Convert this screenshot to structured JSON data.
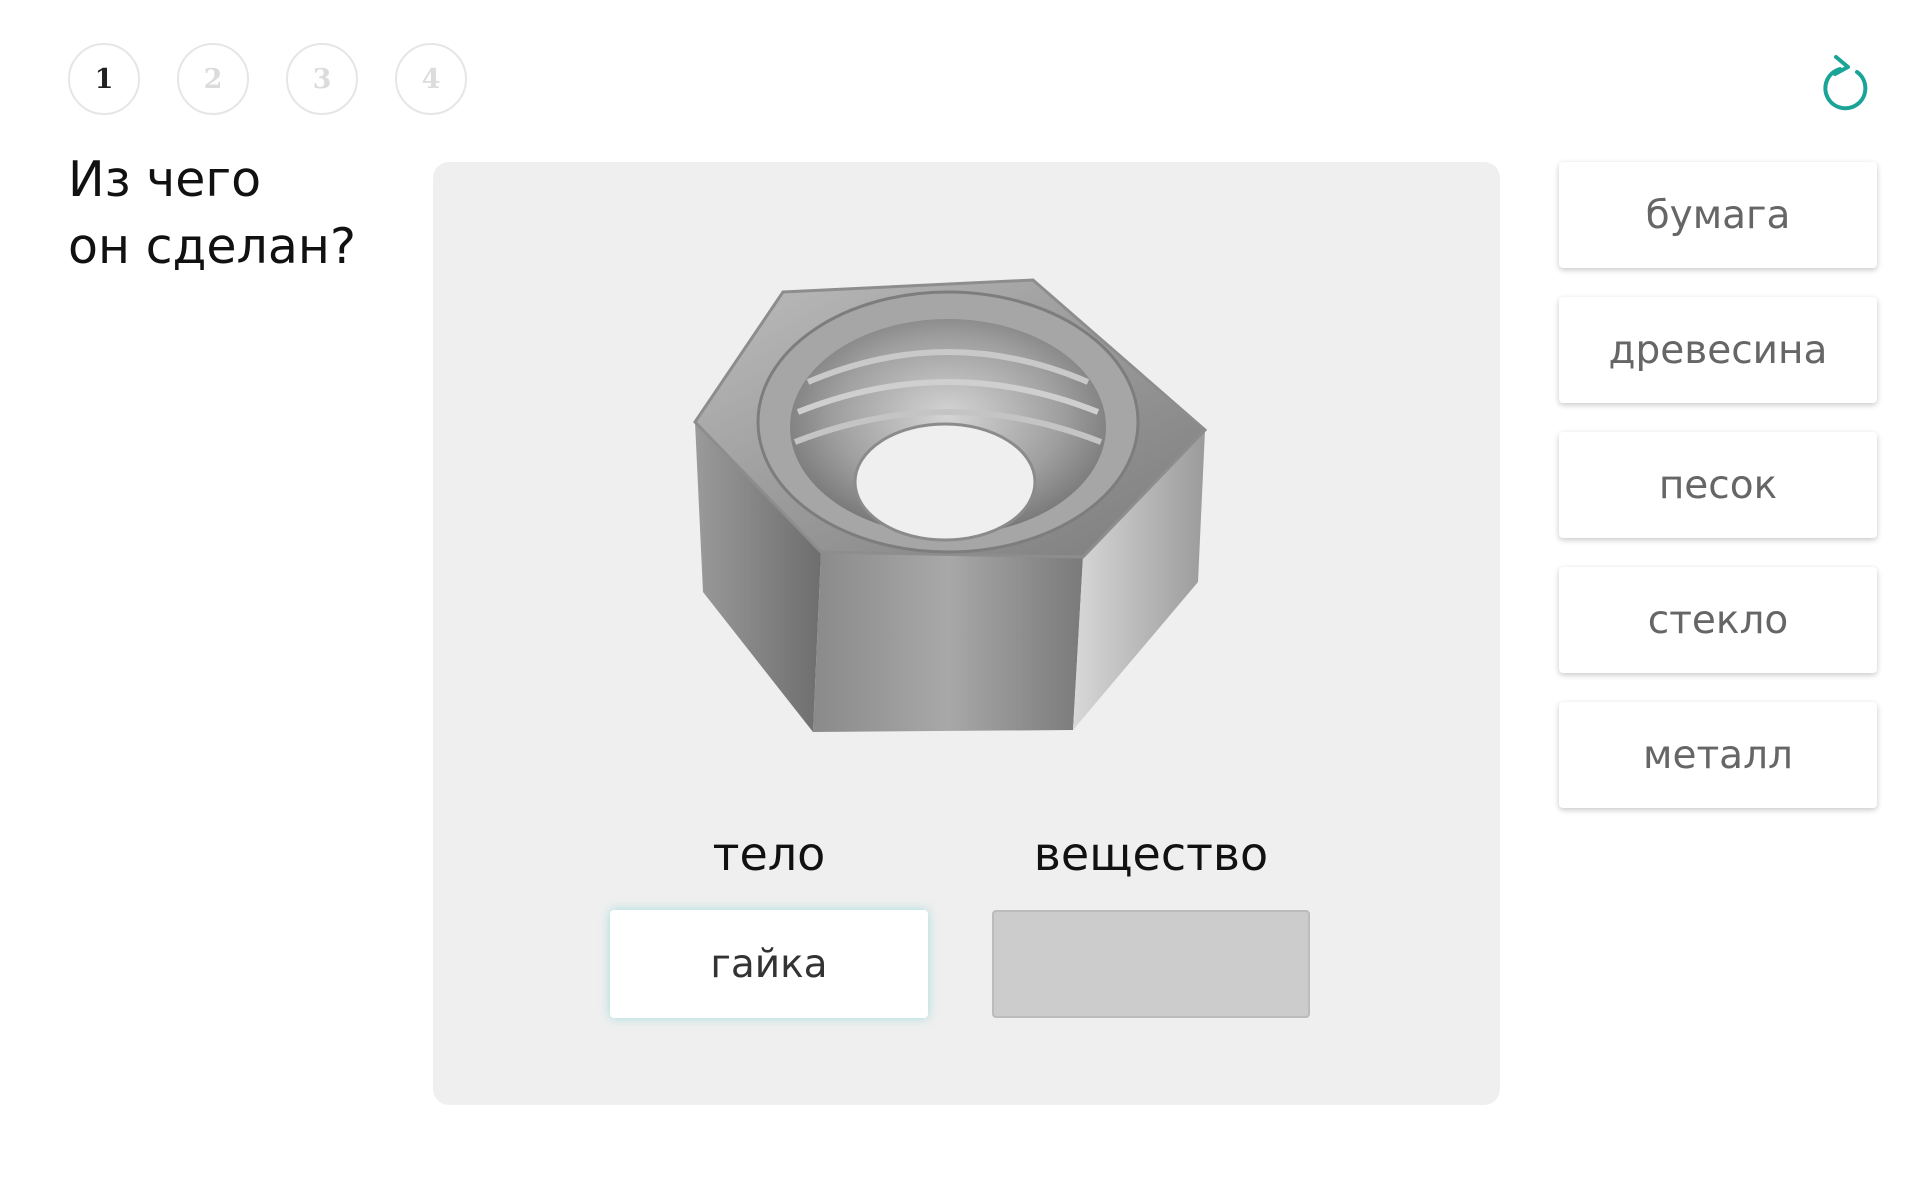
{
  "steps": [
    "1",
    "2",
    "3",
    "4"
  ],
  "active_step": "1",
  "question": {
    "line1": "Из чего",
    "line2": "он сделан?"
  },
  "columns": {
    "body_label": "тело",
    "substance_label": "вещество"
  },
  "slots": {
    "body_value": "гайка",
    "substance_value": ""
  },
  "options": [
    "бумага",
    "древесина",
    "песок",
    "стекло",
    "металл"
  ],
  "image": {
    "subject": "hex-nut",
    "tone": "steel-grey"
  },
  "colors": {
    "accent": "#1aa397",
    "card_background": "#efefef",
    "empty_slot": "#cccccc"
  },
  "icons": {
    "reset": "reset-icon"
  }
}
